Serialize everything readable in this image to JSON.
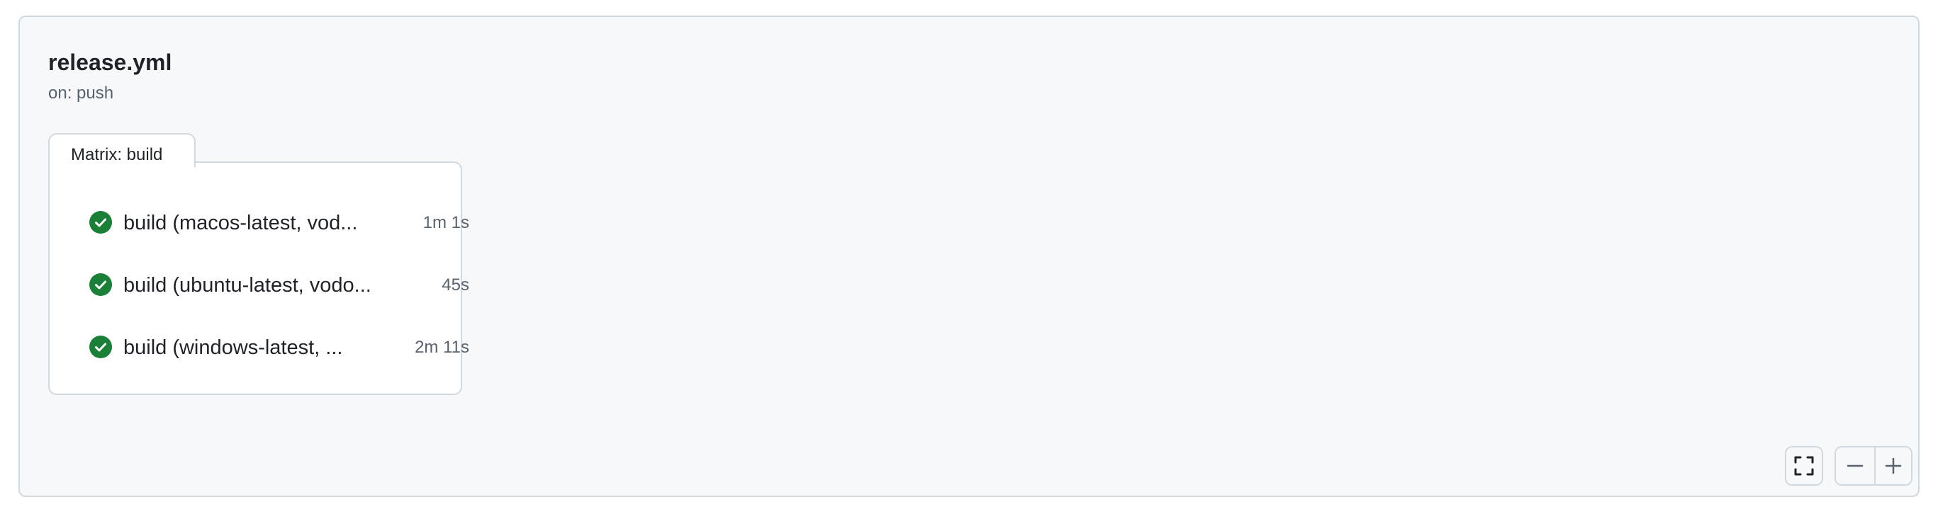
{
  "workflow": {
    "title": "release.yml",
    "trigger": "on: push"
  },
  "matrix": {
    "label": "Matrix: build",
    "jobs": [
      {
        "name": "build (macos-latest, vod...",
        "duration": "1m 1s",
        "status": "success"
      },
      {
        "name": "build (ubuntu-latest, vodo...",
        "duration": "45s",
        "status": "success"
      },
      {
        "name": "build (windows-latest, ...",
        "duration": "2m 11s",
        "status": "success"
      }
    ]
  },
  "controls": {
    "fullscreen_icon": "fullscreen-icon",
    "zoom_out_icon": "minus-icon",
    "zoom_in_icon": "plus-icon"
  },
  "colors": {
    "success": "#1a7f37",
    "panel_bg": "#f6f8fa",
    "border": "#d1d9e0"
  }
}
